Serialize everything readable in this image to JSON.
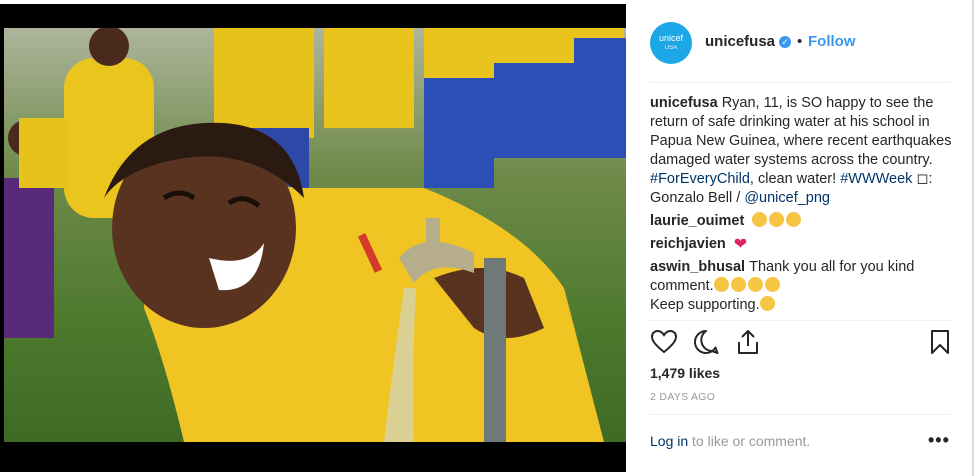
{
  "post": {
    "username": "unicefusa",
    "follow_label": "Follow",
    "separator": "•",
    "avatar": {
      "line1": "unicef",
      "line2": "USA",
      "color": "#1ca7e6"
    },
    "verified_icon": "verified-badge-icon"
  },
  "caption": {
    "user": "unicefusa",
    "text": "Ryan, 11, is SO happy to see the return of safe drinking water at his school in Papua New Guinea, where recent earthquakes damaged water systems across the country. ",
    "hashtag1": "#ForEveryChild",
    "text2": ", clean water! ",
    "hashtag2": "#WWWeek",
    "camera_glyph": "◻",
    "credit": ": Gonzalo Bell / ",
    "mention": "@unicef_png"
  },
  "comments": [
    {
      "user": "laurie_ouimet",
      "text": "",
      "emojis": [
        "heart-eyes",
        "heart-eyes",
        "heart-eyes"
      ]
    },
    {
      "user": "reichjavien",
      "text": "",
      "emojis": [
        "red-heart"
      ]
    },
    {
      "user": "aswin_bhusal",
      "text": "Thank you all for you kind comment.",
      "emojis": [
        "heart-eyes",
        "heart-eyes",
        "kissing-heart",
        "upside-down"
      ],
      "text2": "Keep supporting.",
      "emojis2": [
        "smiling"
      ]
    }
  ],
  "actions": {
    "like_icon": "heart-outline-icon",
    "comment_icon": "comment-bubble-icon",
    "share_icon": "share-icon",
    "save_icon": "bookmark-icon"
  },
  "likes": "1,479 likes",
  "timestamp": "2 DAYS AGO",
  "login": {
    "link": "Log in",
    "rest": " to like or comment."
  },
  "more_label": "•••",
  "colors": {
    "link": "#003569",
    "follow": "#3897f0",
    "muted": "#999999",
    "heart": "#e0245e"
  }
}
